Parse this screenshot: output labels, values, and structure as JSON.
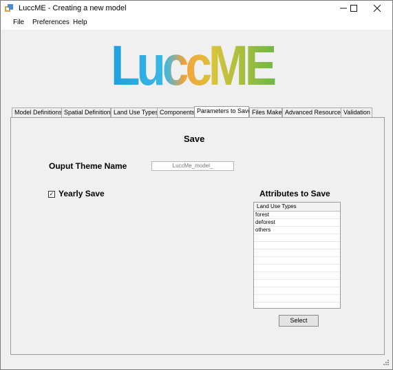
{
  "window": {
    "title": "LuccME - Creating a new model",
    "controls": [
      "minimize-icon",
      "maximize-icon",
      "close-icon"
    ]
  },
  "menu": {
    "items": [
      "File",
      "Preferences",
      "Help"
    ]
  },
  "logo": {
    "text": "LuccME",
    "colors": [
      "#1ea0df",
      "#2fb7e6",
      "#f4a23a",
      "#d8c23c",
      "#9dcc4a",
      "#6fb843"
    ]
  },
  "tabs": [
    "Model Definitions",
    "Spatial Definitions",
    "Land Use Types",
    "Components",
    "Parameters to Save",
    "Files Maker",
    "Advanced Resources",
    "Validation"
  ],
  "active_tab": "Parameters to Save",
  "panel": {
    "section_title": "Save",
    "output_theme_label": "Ouput Theme Name",
    "output_theme_placeholder": "LuccMe_model_",
    "yearly_save_label": "Yearly Save",
    "yearly_save_checked": true,
    "attributes_label": "Attributes to Save",
    "list_header": "Land Use Types",
    "list_items": [
      "forest",
      "deforest",
      "others"
    ],
    "select_button": "Select"
  }
}
